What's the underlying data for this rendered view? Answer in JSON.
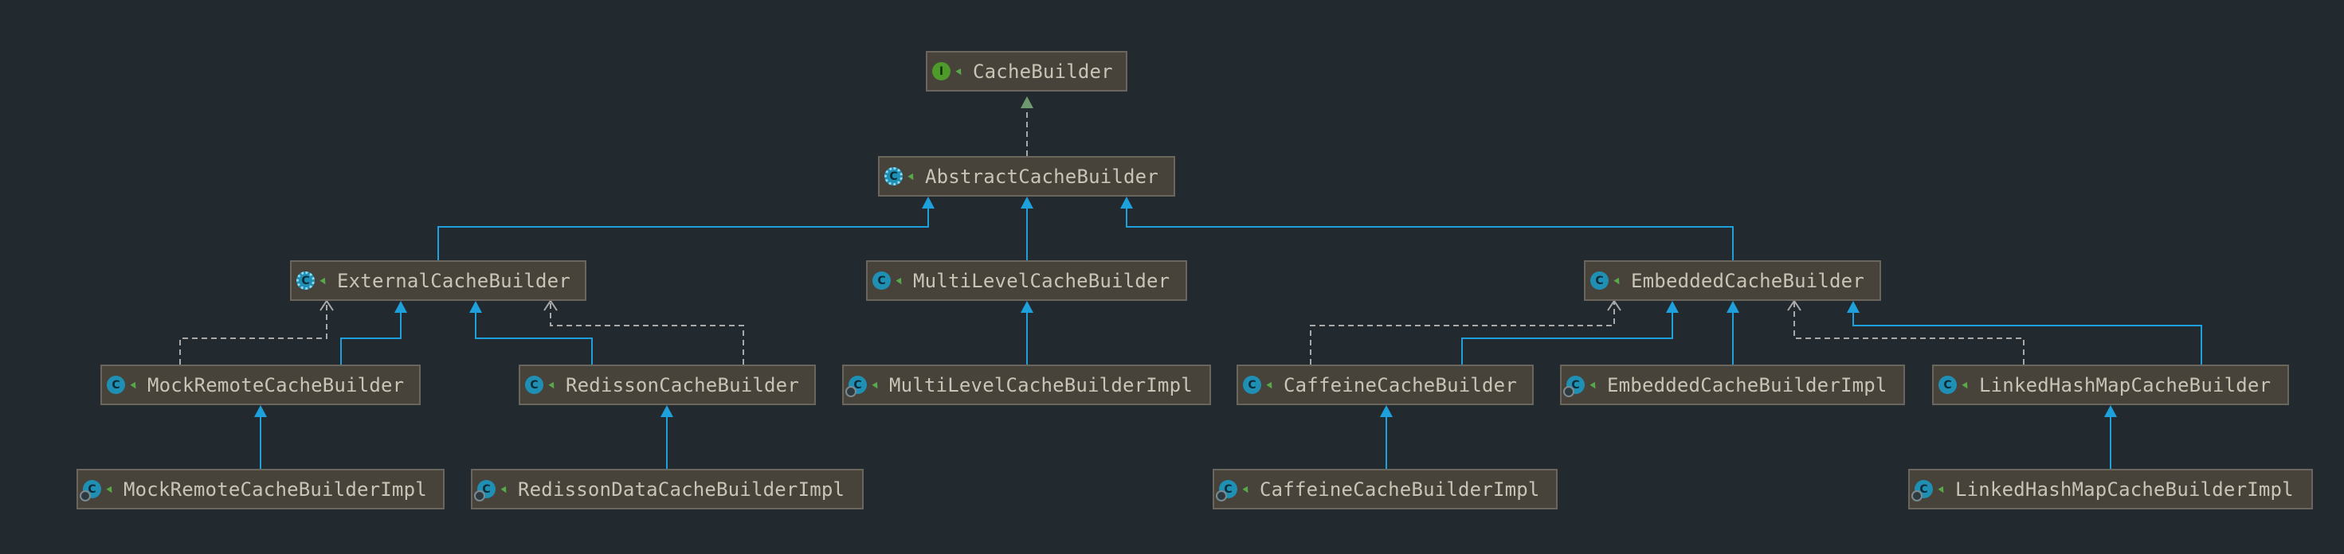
{
  "colors": {
    "background": "#222a30",
    "extends_edge": "#1ea0dc",
    "implements_edge": "#a9a9a9",
    "interface_arrow": "#6f9a6f",
    "node_fill": "#47433a",
    "node_border": "#6a665d",
    "label": "#c9c4b6"
  },
  "nodes": [
    {
      "id": "cache-builder",
      "label": "CacheBuilder",
      "kind": "interface",
      "icon": "interface-icon",
      "glyph": "I"
    },
    {
      "id": "abstract-cache-builder",
      "label": "AbstractCacheBuilder",
      "kind": "abstract",
      "icon": "abstract-class-icon",
      "glyph": "C"
    },
    {
      "id": "external-cache-builder",
      "label": "ExternalCacheBuilder",
      "kind": "abstract",
      "icon": "abstract-class-icon",
      "glyph": "C"
    },
    {
      "id": "multi-level-cache-builder",
      "label": "MultiLevelCacheBuilder",
      "kind": "class",
      "icon": "class-icon",
      "glyph": "C"
    },
    {
      "id": "embedded-cache-builder",
      "label": "EmbeddedCacheBuilder",
      "kind": "class",
      "icon": "class-icon",
      "glyph": "C"
    },
    {
      "id": "mock-remote-cache-builder",
      "label": "MockRemoteCacheBuilder",
      "kind": "class",
      "icon": "class-icon",
      "glyph": "C"
    },
    {
      "id": "redisson-cache-builder",
      "label": "RedissonCacheBuilder",
      "kind": "class",
      "icon": "class-icon",
      "glyph": "C"
    },
    {
      "id": "multi-level-cache-builder-impl",
      "label": "MultiLevelCacheBuilderImpl",
      "kind": "static",
      "icon": "static-class-icon",
      "glyph": "C"
    },
    {
      "id": "caffeine-cache-builder",
      "label": "CaffeineCacheBuilder",
      "kind": "class",
      "icon": "class-icon",
      "glyph": "C"
    },
    {
      "id": "embedded-cache-builder-impl",
      "label": "EmbeddedCacheBuilderImpl",
      "kind": "static",
      "icon": "static-class-icon",
      "glyph": "C"
    },
    {
      "id": "linked-hash-map-cache-builder",
      "label": "LinkedHashMapCacheBuilder",
      "kind": "class",
      "icon": "class-icon",
      "glyph": "C"
    },
    {
      "id": "mock-remote-cache-builder-impl",
      "label": "MockRemoteCacheBuilderImpl",
      "kind": "static",
      "icon": "static-class-icon",
      "glyph": "C"
    },
    {
      "id": "redisson-data-cache-builder-impl",
      "label": "RedissonDataCacheBuilderImpl",
      "kind": "static",
      "icon": "static-class-icon",
      "glyph": "C"
    },
    {
      "id": "caffeine-cache-builder-impl",
      "label": "CaffeineCacheBuilderImpl",
      "kind": "static",
      "icon": "static-class-icon",
      "glyph": "C"
    },
    {
      "id": "linked-hash-map-cache-builder-impl",
      "label": "LinkedHashMapCacheBuilderImpl",
      "kind": "static",
      "icon": "static-class-icon",
      "glyph": "C"
    }
  ],
  "edges": [
    {
      "from": "abstract-cache-builder",
      "to": "cache-builder",
      "type": "implements-interface"
    },
    {
      "from": "external-cache-builder",
      "to": "abstract-cache-builder",
      "type": "extends"
    },
    {
      "from": "multi-level-cache-builder",
      "to": "abstract-cache-builder",
      "type": "extends"
    },
    {
      "from": "embedded-cache-builder",
      "to": "abstract-cache-builder",
      "type": "extends"
    },
    {
      "from": "mock-remote-cache-builder",
      "to": "external-cache-builder",
      "type": "extends"
    },
    {
      "from": "mock-remote-cache-builder",
      "to": "external-cache-builder",
      "type": "dependency"
    },
    {
      "from": "redisson-cache-builder",
      "to": "external-cache-builder",
      "type": "extends"
    },
    {
      "from": "redisson-cache-builder",
      "to": "external-cache-builder",
      "type": "dependency"
    },
    {
      "from": "multi-level-cache-builder-impl",
      "to": "multi-level-cache-builder",
      "type": "extends"
    },
    {
      "from": "caffeine-cache-builder",
      "to": "embedded-cache-builder",
      "type": "extends"
    },
    {
      "from": "caffeine-cache-builder",
      "to": "embedded-cache-builder",
      "type": "dependency"
    },
    {
      "from": "embedded-cache-builder-impl",
      "to": "embedded-cache-builder",
      "type": "extends"
    },
    {
      "from": "linked-hash-map-cache-builder",
      "to": "embedded-cache-builder",
      "type": "extends"
    },
    {
      "from": "linked-hash-map-cache-builder",
      "to": "embedded-cache-builder",
      "type": "dependency"
    },
    {
      "from": "mock-remote-cache-builder-impl",
      "to": "mock-remote-cache-builder",
      "type": "extends"
    },
    {
      "from": "redisson-data-cache-builder-impl",
      "to": "redisson-cache-builder",
      "type": "extends"
    },
    {
      "from": "caffeine-cache-builder-impl",
      "to": "caffeine-cache-builder",
      "type": "extends"
    },
    {
      "from": "linked-hash-map-cache-builder-impl",
      "to": "linked-hash-map-cache-builder",
      "type": "extends"
    }
  ]
}
